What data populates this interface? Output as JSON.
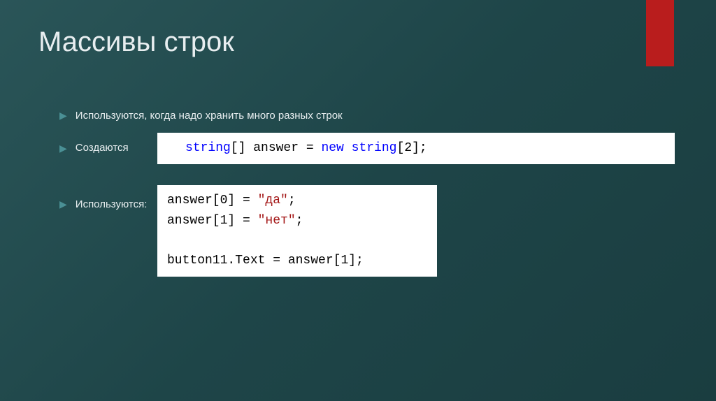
{
  "title": "Массивы строк",
  "bullets": {
    "item1": "Используются, когда надо хранить много разных строк",
    "item2": "Создаются",
    "item3": "Используются:"
  },
  "code1": {
    "keyword1": "string",
    "brackets1": "[] answer = ",
    "keyword2": "new",
    "space": " ",
    "keyword3": "string",
    "brackets2": "[2];"
  },
  "code2": {
    "line1a": "answer[0] = ",
    "line1b": "\"да\"",
    "line1c": ";",
    "line2a": "answer[1] = ",
    "line2b": "\"нет\"",
    "line2c": ";",
    "line3": "button11.Text = answer[1];"
  }
}
